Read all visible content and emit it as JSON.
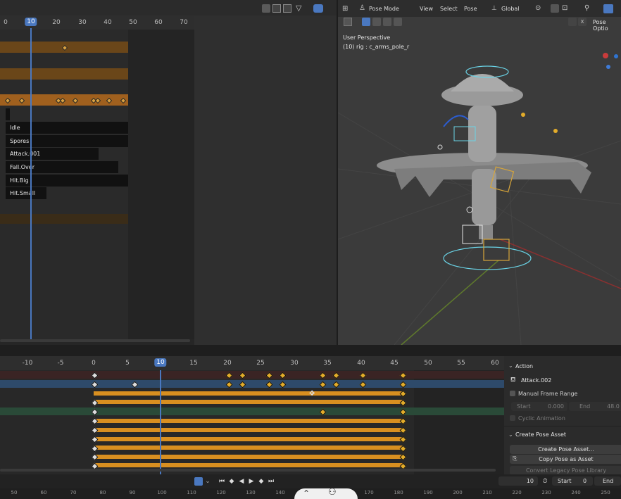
{
  "nla": {
    "ruler_ticks": [
      "0",
      "10",
      "20",
      "30",
      "40",
      "50",
      "60",
      "70"
    ],
    "current_frame": "10",
    "actions": [
      "Idle",
      "Spores",
      "Attack.001",
      "Fall.Over",
      "Hit.Big",
      "Hit.Small"
    ]
  },
  "viewport": {
    "mode": "Pose Mode",
    "menus": [
      "View",
      "Select",
      "Pose"
    ],
    "orientation": "Global",
    "pose_options": "Pose Optio",
    "view_name": "User Perspective",
    "context": "(10) rig : c_arms_pole_r"
  },
  "dopesheet": {
    "ruler_ticks": [
      "-10",
      "-5",
      "0",
      "5",
      "10",
      "15",
      "20",
      "25",
      "30",
      "35",
      "40",
      "45",
      "50",
      "55",
      "60"
    ],
    "current_frame": "10"
  },
  "panel": {
    "action_header": "Action",
    "action_name": "Attack.002",
    "manual_frame_range": "Manual Frame Range",
    "start_label": "Start",
    "start_value": "0.000",
    "end_label": "End",
    "end_value": "48.0",
    "cyclic": "Cyclic Animation",
    "create_pose_header": "Create Pose Asset",
    "create_pose_btn": "Create Pose Asset...",
    "copy_pose_btn": "Copy Pose as Asset",
    "convert_legacy": "Convert Legacy Pose Library"
  },
  "timeline": {
    "current_frame": "10",
    "start_label": "Start",
    "start_value": "0",
    "end_label": "End"
  },
  "bottom_ruler": [
    "50",
    "60",
    "70",
    "80",
    "90",
    "100",
    "110",
    "120",
    "130",
    "140",
    "150",
    "160",
    "170",
    "180",
    "190",
    "200",
    "210",
    "220",
    "230",
    "240",
    "250"
  ],
  "colors": {
    "accent": "#4a78c0",
    "orange": "#d88f20",
    "keyframe": "#e3ac2a"
  }
}
